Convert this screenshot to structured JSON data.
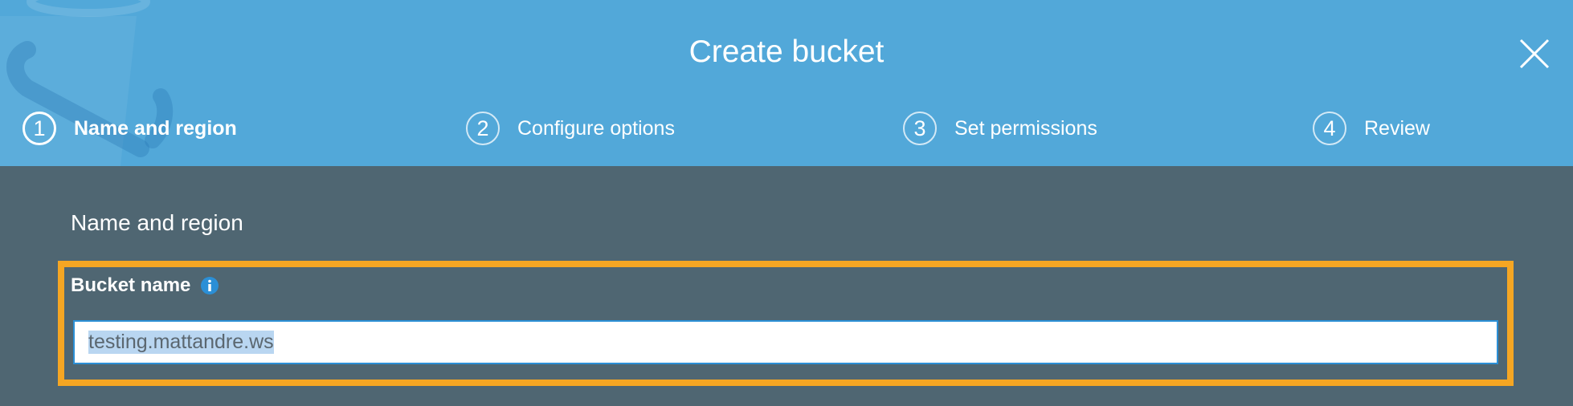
{
  "modal": {
    "title": "Create bucket",
    "close_icon": "close-icon"
  },
  "steps": [
    {
      "number": "1",
      "label": "Name and region",
      "active": true
    },
    {
      "number": "2",
      "label": "Configure options",
      "active": false
    },
    {
      "number": "3",
      "label": "Set permissions",
      "active": false
    },
    {
      "number": "4",
      "label": "Review",
      "active": false
    }
  ],
  "section": {
    "title": "Name and region"
  },
  "bucket_name": {
    "label": "Bucket name",
    "info_icon": "info-icon",
    "value": "testing.mattandre.ws",
    "value_selected": true
  },
  "colors": {
    "header_bg": "#52a8d9",
    "body_bg": "#4f6672",
    "highlight_border": "#f5a623",
    "input_border": "#2b8fd6",
    "selection": "#b9d6f1"
  }
}
